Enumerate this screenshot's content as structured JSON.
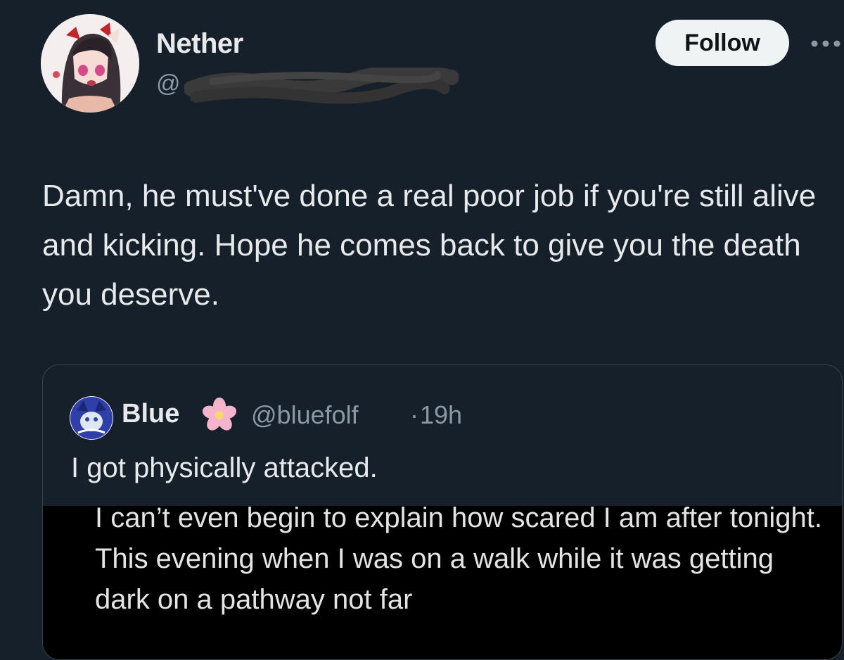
{
  "post": {
    "author": {
      "display_name": "Nether",
      "handle_prefix": "@",
      "avatar_icon": "anime-avatar-icon",
      "handle_redacted": true
    },
    "follow_label": "Follow",
    "more_icon": "more-options-icon",
    "text": "Damn, he must've done a real poor job if you're still alive and kicking. Hope he comes back to give you the death you deserve."
  },
  "quote": {
    "author": {
      "display_name": "Blue",
      "badge_icon": "cherry-blossom-icon",
      "handle": "@bluefolf",
      "separator": "·",
      "time": "19h"
    },
    "text": "I got physically attacked.",
    "attached_image": {
      "lines": "I can’t even begin to explain how scared I am after tonight. This evening when I was on a walk while it was getting dark on a pathway not far"
    }
  },
  "colors": {
    "background": "#15202b",
    "text_primary": "#e7e9ea",
    "text_secondary": "#8b98a5",
    "follow_bg": "#eff3f4",
    "border": "#38444d"
  }
}
